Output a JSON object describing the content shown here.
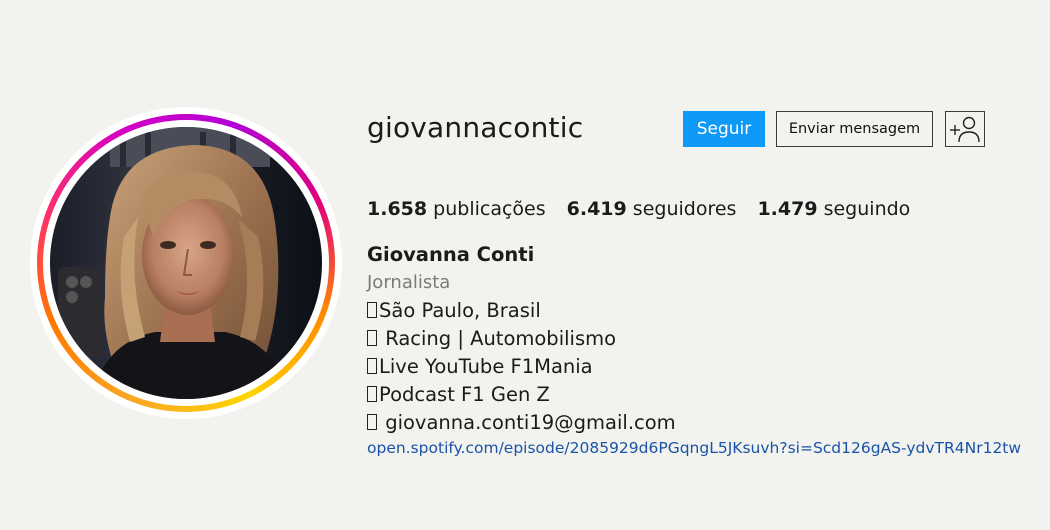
{
  "profile": {
    "username": "giovannacontic",
    "avatar_icon": "profile-photo",
    "story_ring_colors": [
      "#f9a825",
      "#ff7a00",
      "#ff2f6d",
      "#d300c5",
      "#ffd400"
    ]
  },
  "actions": {
    "follow_label": "Seguir",
    "message_label": "Enviar mensagem",
    "add_user_icon": "add-user-icon",
    "follow_color": "#0d99f5"
  },
  "stats": {
    "posts_count": "1.658",
    "posts_label": "publicações",
    "followers_count": "6.419",
    "followers_label": "seguidores",
    "following_count": "1.479",
    "following_label": "seguindo"
  },
  "bio": {
    "full_name": "Giovanna Conti",
    "category": "Jornalista",
    "lines": [
      "São Paulo, Brasil",
      " Racing | Automobilismo",
      "Live YouTube F1Mania",
      "Podcast F1 Gen Z",
      " giovanna.conti19@gmail.com"
    ],
    "link": "open.spotify.com/episode/2085929d6PGqngL5JKsuvh?si=Scd126gAS-ydvTR4Nr12tw",
    "link_color": "#1a53a8"
  }
}
